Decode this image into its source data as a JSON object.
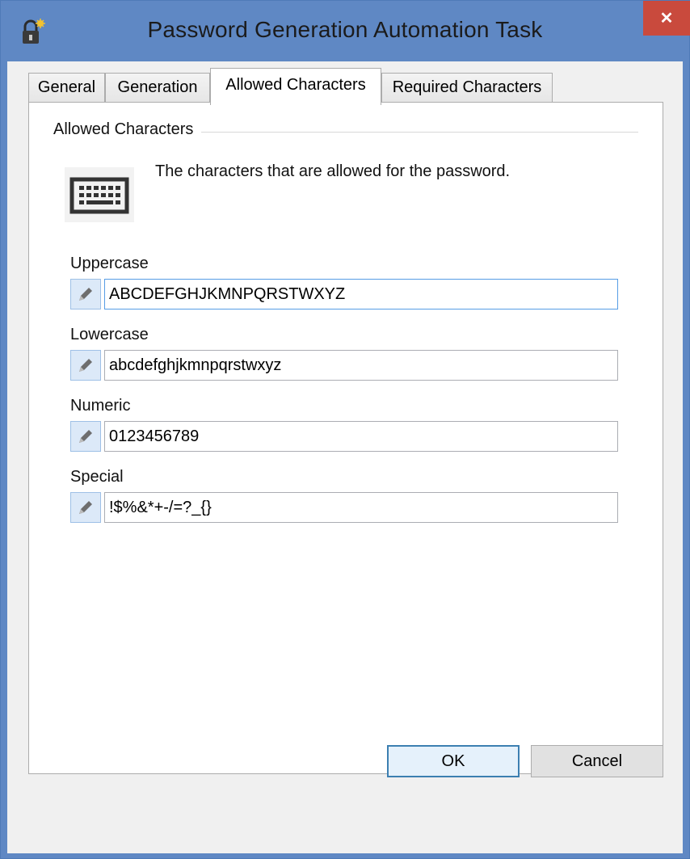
{
  "window": {
    "title": "Password Generation Automation Task",
    "close_glyph": "✕",
    "app_icon": "lock-icon"
  },
  "tabs": [
    {
      "label": "General",
      "active": false
    },
    {
      "label": "Generation",
      "active": false
    },
    {
      "label": "Allowed Characters",
      "active": true
    },
    {
      "label": "Required Characters",
      "active": false
    }
  ],
  "section": {
    "group_label": "Allowed Characters",
    "description": "The characters that are allowed for the password.",
    "icon": "keyboard-icon"
  },
  "fields": {
    "uppercase": {
      "label": "Uppercase",
      "value": "ABCDEFGHJKMNPQRSTWXYZ"
    },
    "lowercase": {
      "label": "Lowercase",
      "value": "abcdefghjkmnpqrstwxyz"
    },
    "numeric": {
      "label": "Numeric",
      "value": "0123456789"
    },
    "special": {
      "label": "Special",
      "value": "!$%&*+-/=?_{}"
    }
  },
  "buttons": {
    "ok": "OK",
    "cancel": "Cancel"
  },
  "colors": {
    "title_bar": "#5f88c4",
    "close_button": "#c94a3d",
    "focus_border": "#569de5"
  }
}
